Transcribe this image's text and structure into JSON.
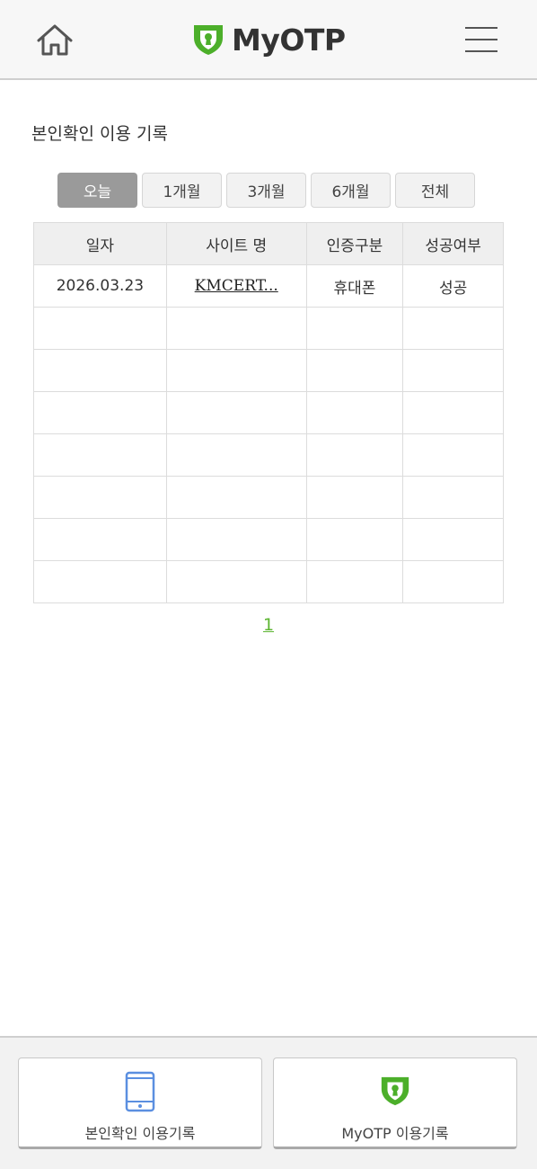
{
  "header": {
    "home_icon": "home-icon",
    "logo_icon": "shield-keyhole-icon",
    "logo_text": "MyOTP",
    "menu_icon": "hamburger-menu-icon",
    "brand_color": "#4caf2a"
  },
  "page": {
    "title": "본인확인 이용 기록"
  },
  "tabs": [
    {
      "label": "오늘",
      "active": true
    },
    {
      "label": "1개월",
      "active": false
    },
    {
      "label": "3개월",
      "active": false
    },
    {
      "label": "6개월",
      "active": false
    },
    {
      "label": "전체",
      "active": false
    }
  ],
  "table": {
    "headers": [
      "일자",
      "사이트 명",
      "인증구분",
      "성공여부"
    ],
    "rows": [
      {
        "date": "2026.03.23",
        "site": "KMCERT...",
        "auth": "휴대폰",
        "result": "성공"
      }
    ]
  },
  "pagination": {
    "current": "1",
    "color": "#5cb531"
  },
  "footer": {
    "identity_button": {
      "label": "본인확인 이용기록",
      "icon": "smartphone-icon",
      "icon_color": "#5b8fe0"
    },
    "otp_button": {
      "label": "MyOTP 이용기록",
      "icon": "shield-keyhole-icon",
      "icon_color": "#4caf2a"
    }
  }
}
